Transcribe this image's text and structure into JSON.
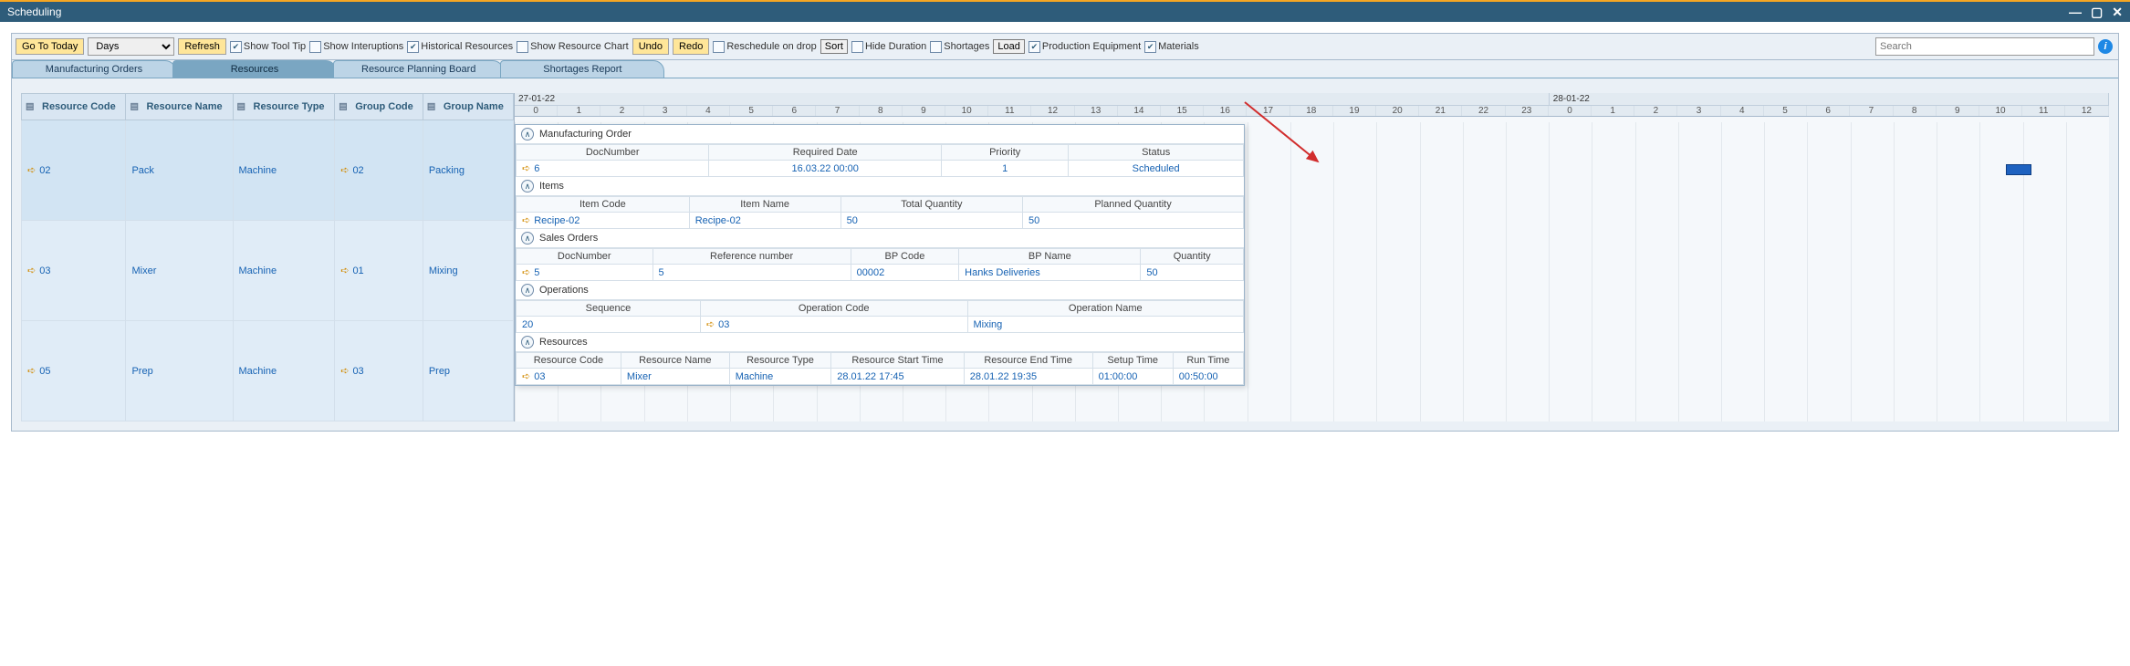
{
  "window": {
    "title": "Scheduling"
  },
  "toolbar": {
    "goto_today": "Go To Today",
    "timeunit_options": [
      "Days"
    ],
    "timeunit_selected": "Days",
    "refresh": "Refresh",
    "show_tooltip": "Show Tool Tip",
    "show_interruptions": "Show Interuptions",
    "historical_resources": "Historical Resources",
    "show_resource_chart": "Show Resource Chart",
    "undo": "Undo",
    "redo": "Redo",
    "reschedule_on_drop": "Reschedule on drop",
    "sort": "Sort",
    "hide_duration": "Hide Duration",
    "shortages": "Shortages",
    "load": "Load",
    "production_equipment": "Production Equipment",
    "materials": "Materials",
    "search_placeholder": "Search"
  },
  "tabs": [
    {
      "label": "Manufacturing Orders"
    },
    {
      "label": "Resources"
    },
    {
      "label": "Resource Planning Board"
    },
    {
      "label": "Shortages Report"
    }
  ],
  "resource_cols": [
    "Resource Code",
    "Resource Name",
    "Resource Type",
    "Group Code",
    "Group Name"
  ],
  "resources": [
    {
      "code": "02",
      "name": "Pack",
      "type": "Machine",
      "group_code": "02",
      "group_name": "Packing"
    },
    {
      "code": "03",
      "name": "Mixer",
      "type": "Machine",
      "group_code": "01",
      "group_name": "Mixing"
    },
    {
      "code": "05",
      "name": "Prep",
      "type": "Machine",
      "group_code": "03",
      "group_name": "Prep"
    }
  ],
  "timeline": {
    "dates": [
      "27-01-22",
      "28-01-22"
    ],
    "hours": [
      "0",
      "1",
      "2",
      "3",
      "4",
      "5",
      "6",
      "7",
      "8",
      "9",
      "10",
      "11",
      "12",
      "13",
      "14",
      "15",
      "16",
      "17",
      "18",
      "19",
      "20",
      "21",
      "22",
      "23",
      "0",
      "1",
      "2",
      "3",
      "4",
      "5",
      "6",
      "7",
      "8",
      "9",
      "10",
      "11",
      "12"
    ]
  },
  "popover": {
    "manufacturing_order": {
      "title": "Manufacturing Order",
      "cols": [
        "DocNumber",
        "Required Date",
        "Priority",
        "Status"
      ],
      "row": [
        "6",
        "16.03.22 00:00",
        "1",
        "Scheduled"
      ]
    },
    "items": {
      "title": "Items",
      "cols": [
        "Item Code",
        "Item Name",
        "Total Quantity",
        "Planned Quantity"
      ],
      "row": [
        "Recipe-02",
        "Recipe-02",
        "50",
        "50"
      ]
    },
    "sales_orders": {
      "title": "Sales Orders",
      "cols": [
        "DocNumber",
        "Reference number",
        "BP Code",
        "BP Name",
        "Quantity"
      ],
      "row": [
        "5",
        "5",
        "00002",
        "Hanks Deliveries",
        "50"
      ]
    },
    "operations": {
      "title": "Operations",
      "cols": [
        "Sequence",
        "Operation Code",
        "Operation Name"
      ],
      "row": [
        "20",
        "03",
        "Mixing"
      ]
    },
    "resources": {
      "title": "Resources",
      "cols": [
        "Resource Code",
        "Resource Name",
        "Resource Type",
        "Resource Start Time",
        "Resource End Time",
        "Setup Time",
        "Run Time"
      ],
      "row": [
        "03",
        "Mixer",
        "Machine",
        "28.01.22 17:45",
        "28.01.22 19:35",
        "01:00:00",
        "00:50:00"
      ]
    }
  }
}
